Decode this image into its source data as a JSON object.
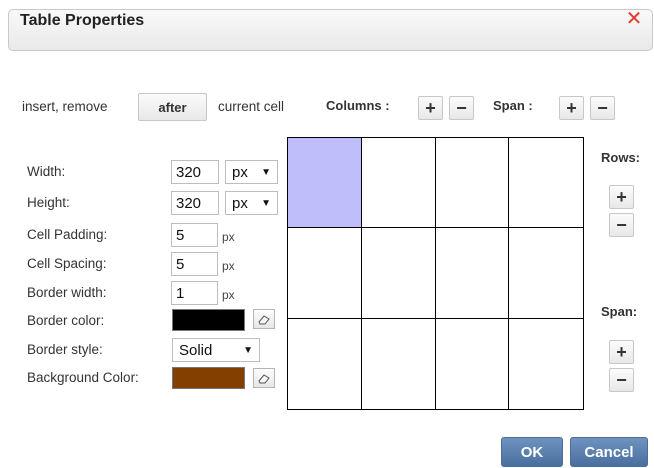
{
  "dialog": {
    "title": "Table Properties"
  },
  "toolbar": {
    "insert_remove_label": "insert, remove",
    "position_button": "after",
    "current_cell_label": "current cell",
    "columns_label": "Columns :",
    "span_label": "Span :",
    "plus": "+",
    "minus": "−"
  },
  "form": {
    "width_label": "Width:",
    "width_value": "320",
    "width_unit": "px",
    "height_label": "Height:",
    "height_value": "320",
    "height_unit": "px",
    "cell_padding_label": "Cell Padding:",
    "cell_padding_value": "5",
    "cell_spacing_label": "Cell Spacing:",
    "cell_spacing_value": "5",
    "border_width_label": "Border width:",
    "border_width_value": "1",
    "unit_px": "px",
    "border_color_label": "Border color:",
    "border_color": "#000000",
    "border_style_label": "Border style:",
    "border_style_value": "Solid",
    "background_color_label": "Background Color:",
    "background_color": "#833f00"
  },
  "side": {
    "rows_label": "Rows:",
    "span_label": "Span:"
  },
  "table": {
    "rows": 3,
    "cols": 4,
    "selected_cell_color": "#c0bdfb"
  },
  "actions": {
    "ok": "OK",
    "cancel": "Cancel"
  }
}
